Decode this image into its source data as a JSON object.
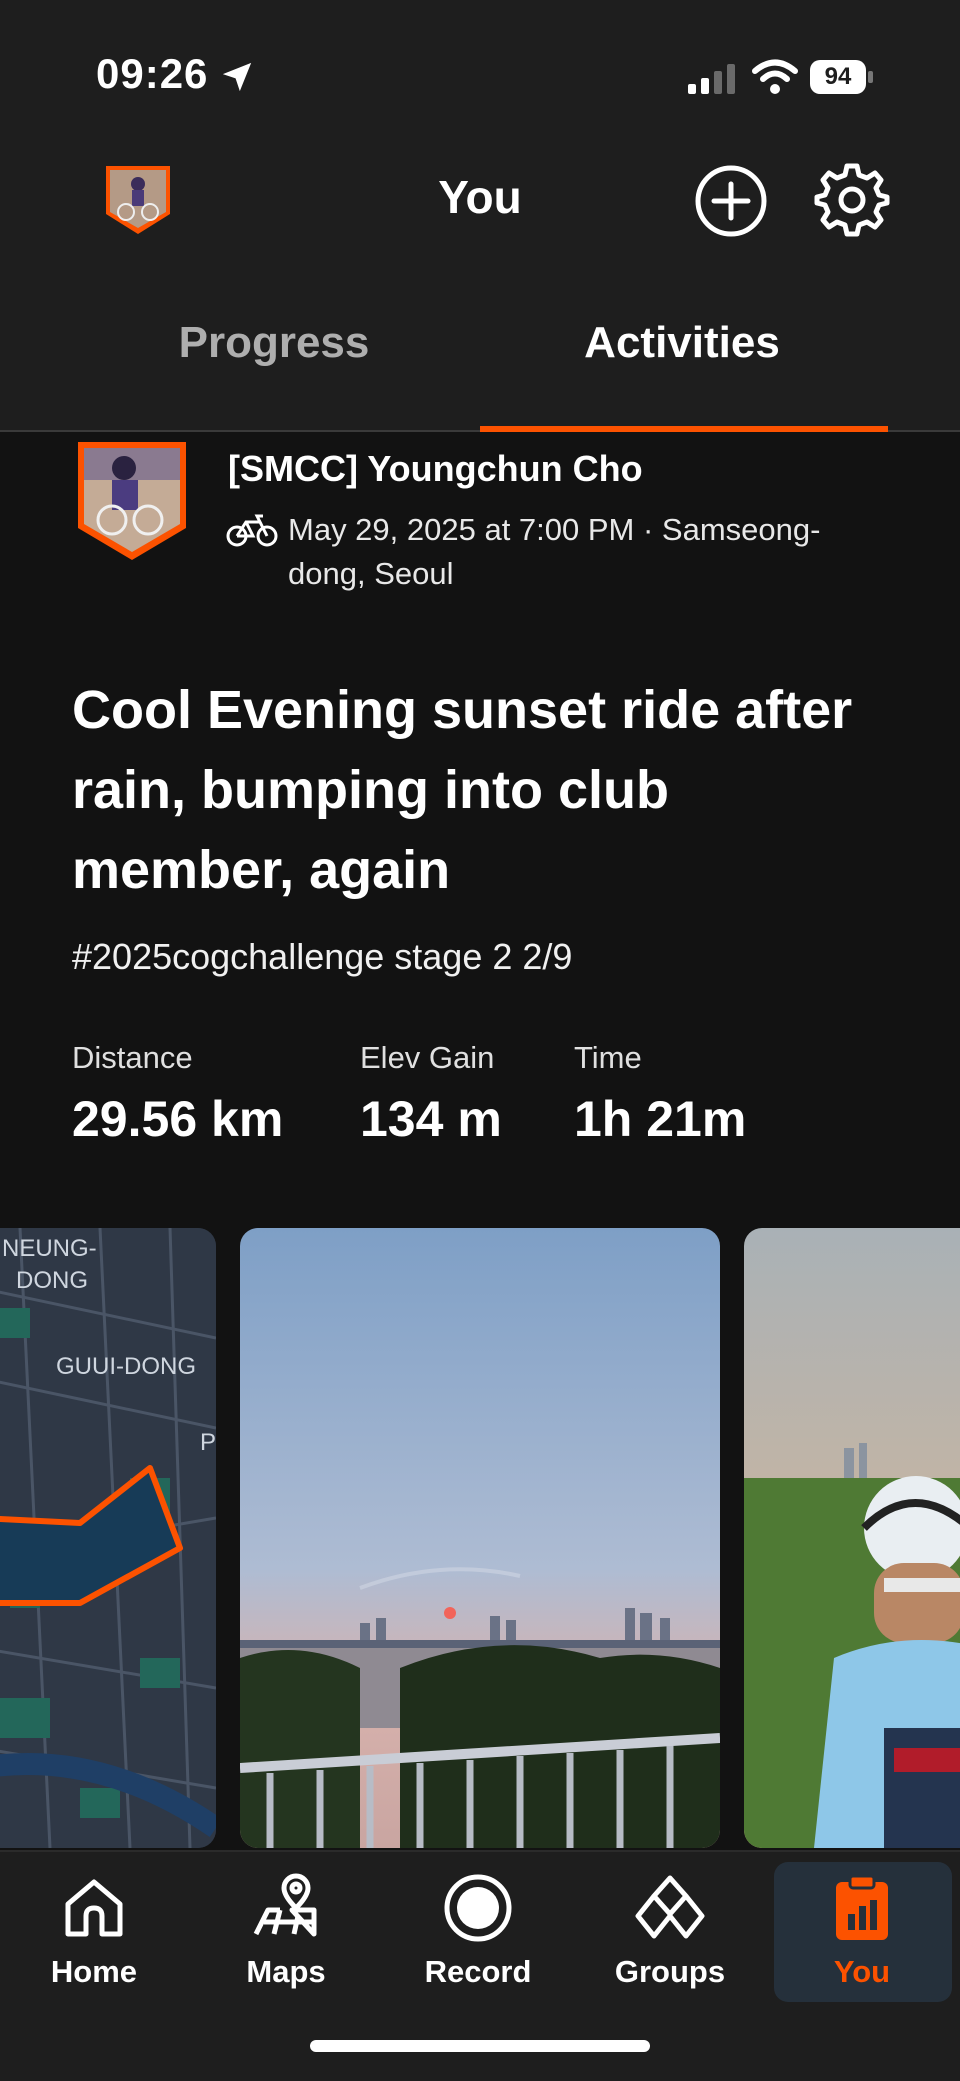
{
  "status_bar": {
    "time": "09:26",
    "battery": "94"
  },
  "header": {
    "title": "You"
  },
  "tabs": [
    {
      "label": "Progress",
      "active": false
    },
    {
      "label": "Activities",
      "active": true
    }
  ],
  "activity": {
    "athlete": "[SMCC] Youngchun Cho",
    "meta": "May 29, 2025 at 7:00 PM · Samseong-dong, Seoul",
    "title": "Cool Evening sunset ride after rain, bumping into club member, again",
    "description": "#2025cogchallenge stage 2 2/9",
    "stats": [
      {
        "label": "Distance",
        "value": "29.56 km"
      },
      {
        "label": "Elev Gain",
        "value": "134 m"
      },
      {
        "label": "Time",
        "value": "1h 21m"
      }
    ],
    "map_labels": {
      "district1": "NEUNG-",
      "district1b": "DONG",
      "district2": "GUUI-DONG",
      "district3": "P"
    }
  },
  "nav": [
    {
      "label": "Home",
      "icon": "home-icon"
    },
    {
      "label": "Maps",
      "icon": "maps-icon"
    },
    {
      "label": "Record",
      "icon": "record-icon"
    },
    {
      "label": "Groups",
      "icon": "groups-icon"
    },
    {
      "label": "You",
      "icon": "you-icon",
      "active": true
    }
  ],
  "colors": {
    "accent": "#fc5200",
    "background": "#121212",
    "header": "#1e1e1e",
    "active_nav_bg": "#25303b"
  }
}
